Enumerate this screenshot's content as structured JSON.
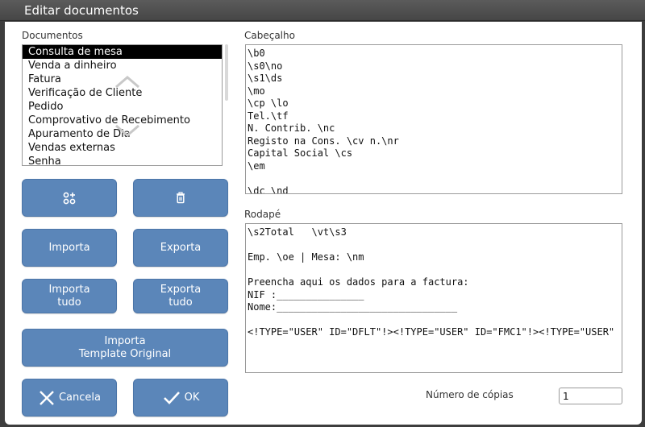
{
  "window": {
    "title": "Editar documentos"
  },
  "documents": {
    "label": "Documentos",
    "items": [
      "Consulta de mesa",
      "Venda a dinheiro",
      "Fatura",
      "Verificação de Cliente",
      "Pedido",
      "Comprovativo de Recebimento",
      "Apuramento de Dia",
      "Vendas externas",
      "Senha"
    ],
    "selected_index": 0
  },
  "buttons": {
    "add_icon": "add-grid-icon",
    "delete_icon": "trash-icon",
    "import": "Importa",
    "export": "Exporta",
    "import_all_1": "Importa",
    "import_all_2": "tudo",
    "export_all_1": "Exporta",
    "export_all_2": "tudo",
    "import_template_1": "Importa",
    "import_template_2": "Template Original",
    "cancel": "Cancela",
    "ok": "OK"
  },
  "header": {
    "label": "Cabeçalho",
    "text": "\\b0\n\\s0\\no\n\\s1\\ds\n\\mo\n\\cp \\lo\nTel.\\tf\nN. Contrib. \\nc\nRegisto na Cons. \\cv n.\\nr\nCapital Social \\cs\n\\em\n\n\\dc \\nd"
  },
  "footer": {
    "label": "Rodapé",
    "text": "\\s2Total   \\vt\\s3\n\nEmp. \\oe | Mesa: \\nm\n\nPreencha aqui os dados para a factura:\nNIF :_______________\nNome:_______________________________\n\n<!TYPE=\"USER\" ID=\"DFLT\"!><!TYPE=\"USER\" ID=\"FMC1\"!><!TYPE=\"USER\""
  },
  "copies": {
    "label": "Número de cópias",
    "value": "1"
  },
  "colors": {
    "button": "#5b86b9",
    "titlebar": "#4f4f4f",
    "selection": "#000000"
  }
}
